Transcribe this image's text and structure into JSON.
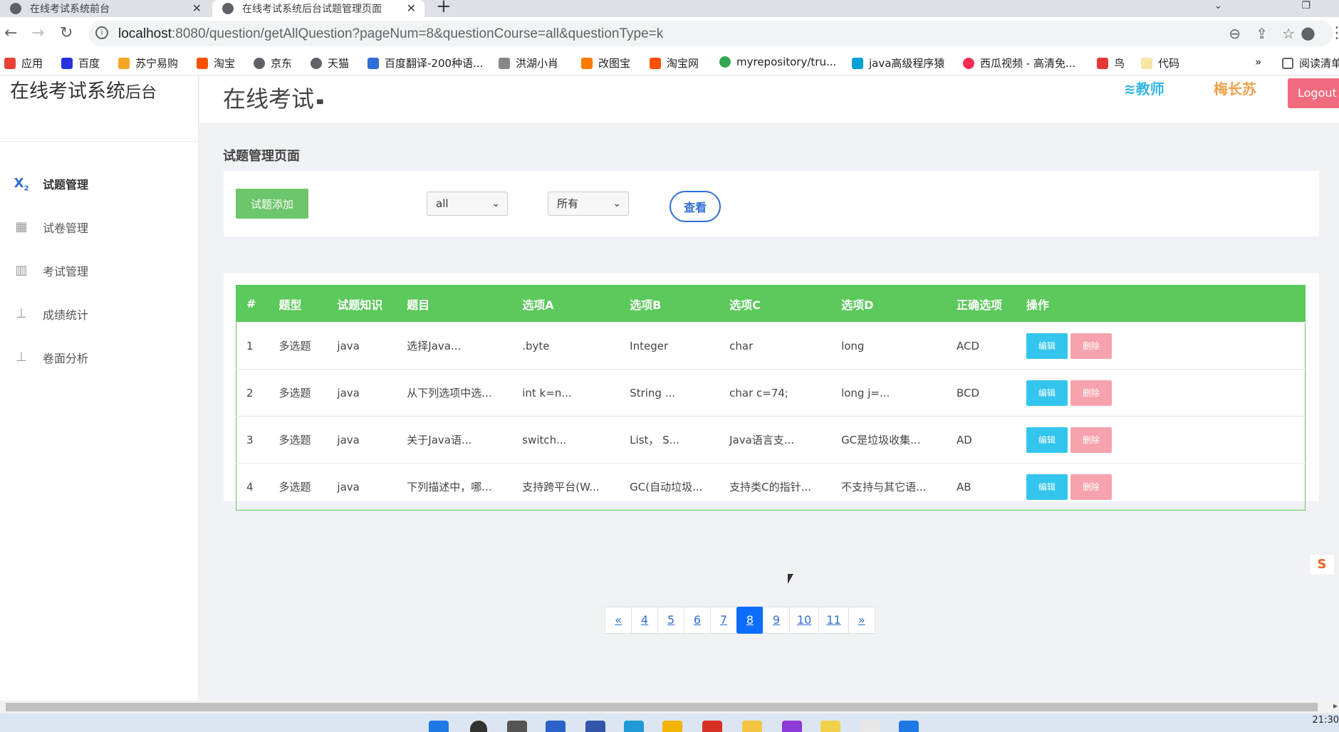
{
  "browser": {
    "tabs": [
      {
        "title": "在线考试系统前台",
        "close": "✕"
      },
      {
        "title": "在线考试系统后台试题管理页面",
        "close": "✕"
      }
    ],
    "new_tab": "+",
    "url_host": "localhost",
    "url_rest": ":8080/question/getAllQuestion?pageNum=8&questionCourse=all&questionType=k",
    "bookmarks": [
      {
        "label": "应用",
        "color": "#e94235"
      },
      {
        "label": "百度",
        "color": "#2932e1"
      },
      {
        "label": "苏宁易购",
        "color": "#f5a623"
      },
      {
        "label": "淘宝",
        "color": "#ff5000"
      },
      {
        "label": "京东",
        "color": "#5f6368"
      },
      {
        "label": "天猫",
        "color": "#5f6368"
      },
      {
        "label": "百度翻译-200种语...",
        "color": "#2e6ed6"
      },
      {
        "label": "洪湖小肖",
        "color": "#888888"
      },
      {
        "label": "改图宝",
        "color": "#ff7a00"
      },
      {
        "label": "淘宝网",
        "color": "#ff5000"
      },
      {
        "label": "myrepository/tru...",
        "color": "#34a853"
      },
      {
        "label": "java高级程序猿",
        "color": "#00a1d6"
      },
      {
        "label": "西瓜视频 - 高清免...",
        "color": "#fe2c55"
      },
      {
        "label": "鸟",
        "color": "#e53935"
      },
      {
        "label": "代码",
        "color": "#f5e6a3"
      }
    ],
    "bookmarks_more": "»",
    "reading_list": "阅读清单"
  },
  "sidebar": {
    "brand_main": "在线考试系统",
    "brand_small": "后台",
    "items": [
      {
        "label": "试题管理",
        "icon": "x2"
      },
      {
        "label": "试卷管理",
        "icon": "grid"
      },
      {
        "label": "考试管理",
        "icon": "map"
      },
      {
        "label": "成绩统计",
        "icon": "sitemap"
      },
      {
        "label": "卷面分析",
        "icon": "sitemap"
      }
    ]
  },
  "header": {
    "title": "在线考试",
    "role": "教师",
    "user": "梅长苏",
    "logout": "Logout"
  },
  "page": {
    "section_title": "试题管理页面",
    "add_button": "试题添加",
    "course_select": "all",
    "type_select": "所有",
    "view_button": "查看"
  },
  "table": {
    "headers": [
      "#",
      "题型",
      "试题知识",
      "题目",
      "选项A",
      "选项B",
      "选项C",
      "选项D",
      "正确选项",
      "操作"
    ],
    "edit_label": "编辑",
    "delete_label": "删除",
    "rows": [
      [
        "1",
        "多选题",
        "java",
        "选择Java...",
        ".byte",
        "Integer",
        "char",
        "long",
        "ACD"
      ],
      [
        "2",
        "多选题",
        "java",
        "从下列选项中选...",
        "int k=n...",
        "String ...",
        "char c=74;",
        "long j=...",
        "BCD"
      ],
      [
        "3",
        "多选题",
        "java",
        "关于Java语...",
        "switch...",
        "List， S...",
        "Java语言支...",
        "GC是垃圾收集...",
        "AD"
      ],
      [
        "4",
        "多选题",
        "java",
        "下列描述中，哪...",
        "支持跨平台(W...",
        "GC(自动垃圾...",
        "支持类C的指针...",
        "不支持与其它语...",
        "AB"
      ]
    ]
  },
  "pagination": {
    "prev": "«",
    "pages": [
      "4",
      "5",
      "6",
      "7",
      "8",
      "9",
      "10",
      "11"
    ],
    "current": "8",
    "next": "»"
  },
  "system": {
    "clock": "21:30",
    "ime": "S"
  }
}
